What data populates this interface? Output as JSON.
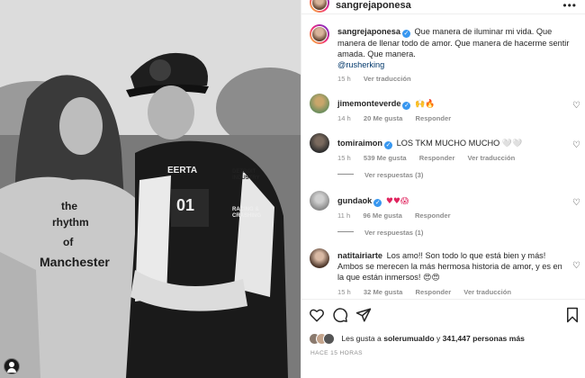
{
  "post": {
    "username": "sangrejaponesa",
    "photo_tshirt_lines": [
      "the",
      "rhythm",
      "of",
      "Manchester"
    ],
    "jacket_texts": [
      "EERTA",
      "DETROIT INDUSTRY",
      "01",
      "RACING & CRASHING"
    ]
  },
  "caption": {
    "username": "sangrejaponesa",
    "text": "Que manera de iluminar mi vida. Que manera de llenar todo de amor. Que manera de hacerme sentir amada. Que manera.",
    "mention": "@rusherking",
    "time": "15 h",
    "translate": "Ver traducción"
  },
  "comments": [
    {
      "username": "jimemonteverde",
      "verified": true,
      "text": "",
      "emoji": "🙌🔥",
      "time": "14 h",
      "likes": "20 Me gusta",
      "reply": "Responder",
      "translate": "",
      "replies": ""
    },
    {
      "username": "tomiraimon",
      "verified": true,
      "text": "LOS TKM MUCHO MUCHO",
      "emoji": "🤍🤍",
      "time": "15 h",
      "likes": "539 Me gusta",
      "reply": "Responder",
      "translate": "Ver traducción",
      "replies": "Ver respuestas (3)"
    },
    {
      "username": "gundaok",
      "verified": true,
      "text": "",
      "emoji": "♥♥😱",
      "time": "11 h",
      "likes": "96 Me gusta",
      "reply": "Responder",
      "translate": "",
      "replies": "Ver respuestas (1)"
    },
    {
      "username": "natitairiarte",
      "verified": false,
      "text": "Los amo!! Son todo lo que está bien y más! Ambos se merecen la más hermosa historia de amor, y es en la que están inmersos!",
      "emoji": "😍😍",
      "time": "15 h",
      "likes": "32 Me gusta",
      "reply": "Responder",
      "translate": "Ver traducción",
      "replies": ""
    }
  ],
  "liked_by": {
    "prefix": "Les gusta a",
    "user": "solerumualdo",
    "connector": "y",
    "count": "341,447 personas más"
  },
  "posted_ago": "HACE 15 HORAS",
  "icons": {
    "more": "more-horizontal-icon",
    "like": "heart-outline-icon",
    "comment": "comment-bubble-icon",
    "share": "paper-plane-icon",
    "save": "bookmark-icon",
    "comment_like": "small-heart-icon",
    "user_tag": "user-tag-icon"
  },
  "colors": {
    "verified_blue": "#3897f0",
    "mention_blue": "#00376b",
    "meta_gray": "#8e8e8e",
    "text": "#262626",
    "story_ring": [
      "#f9ce34",
      "#ee2a7b",
      "#6228d7"
    ]
  }
}
